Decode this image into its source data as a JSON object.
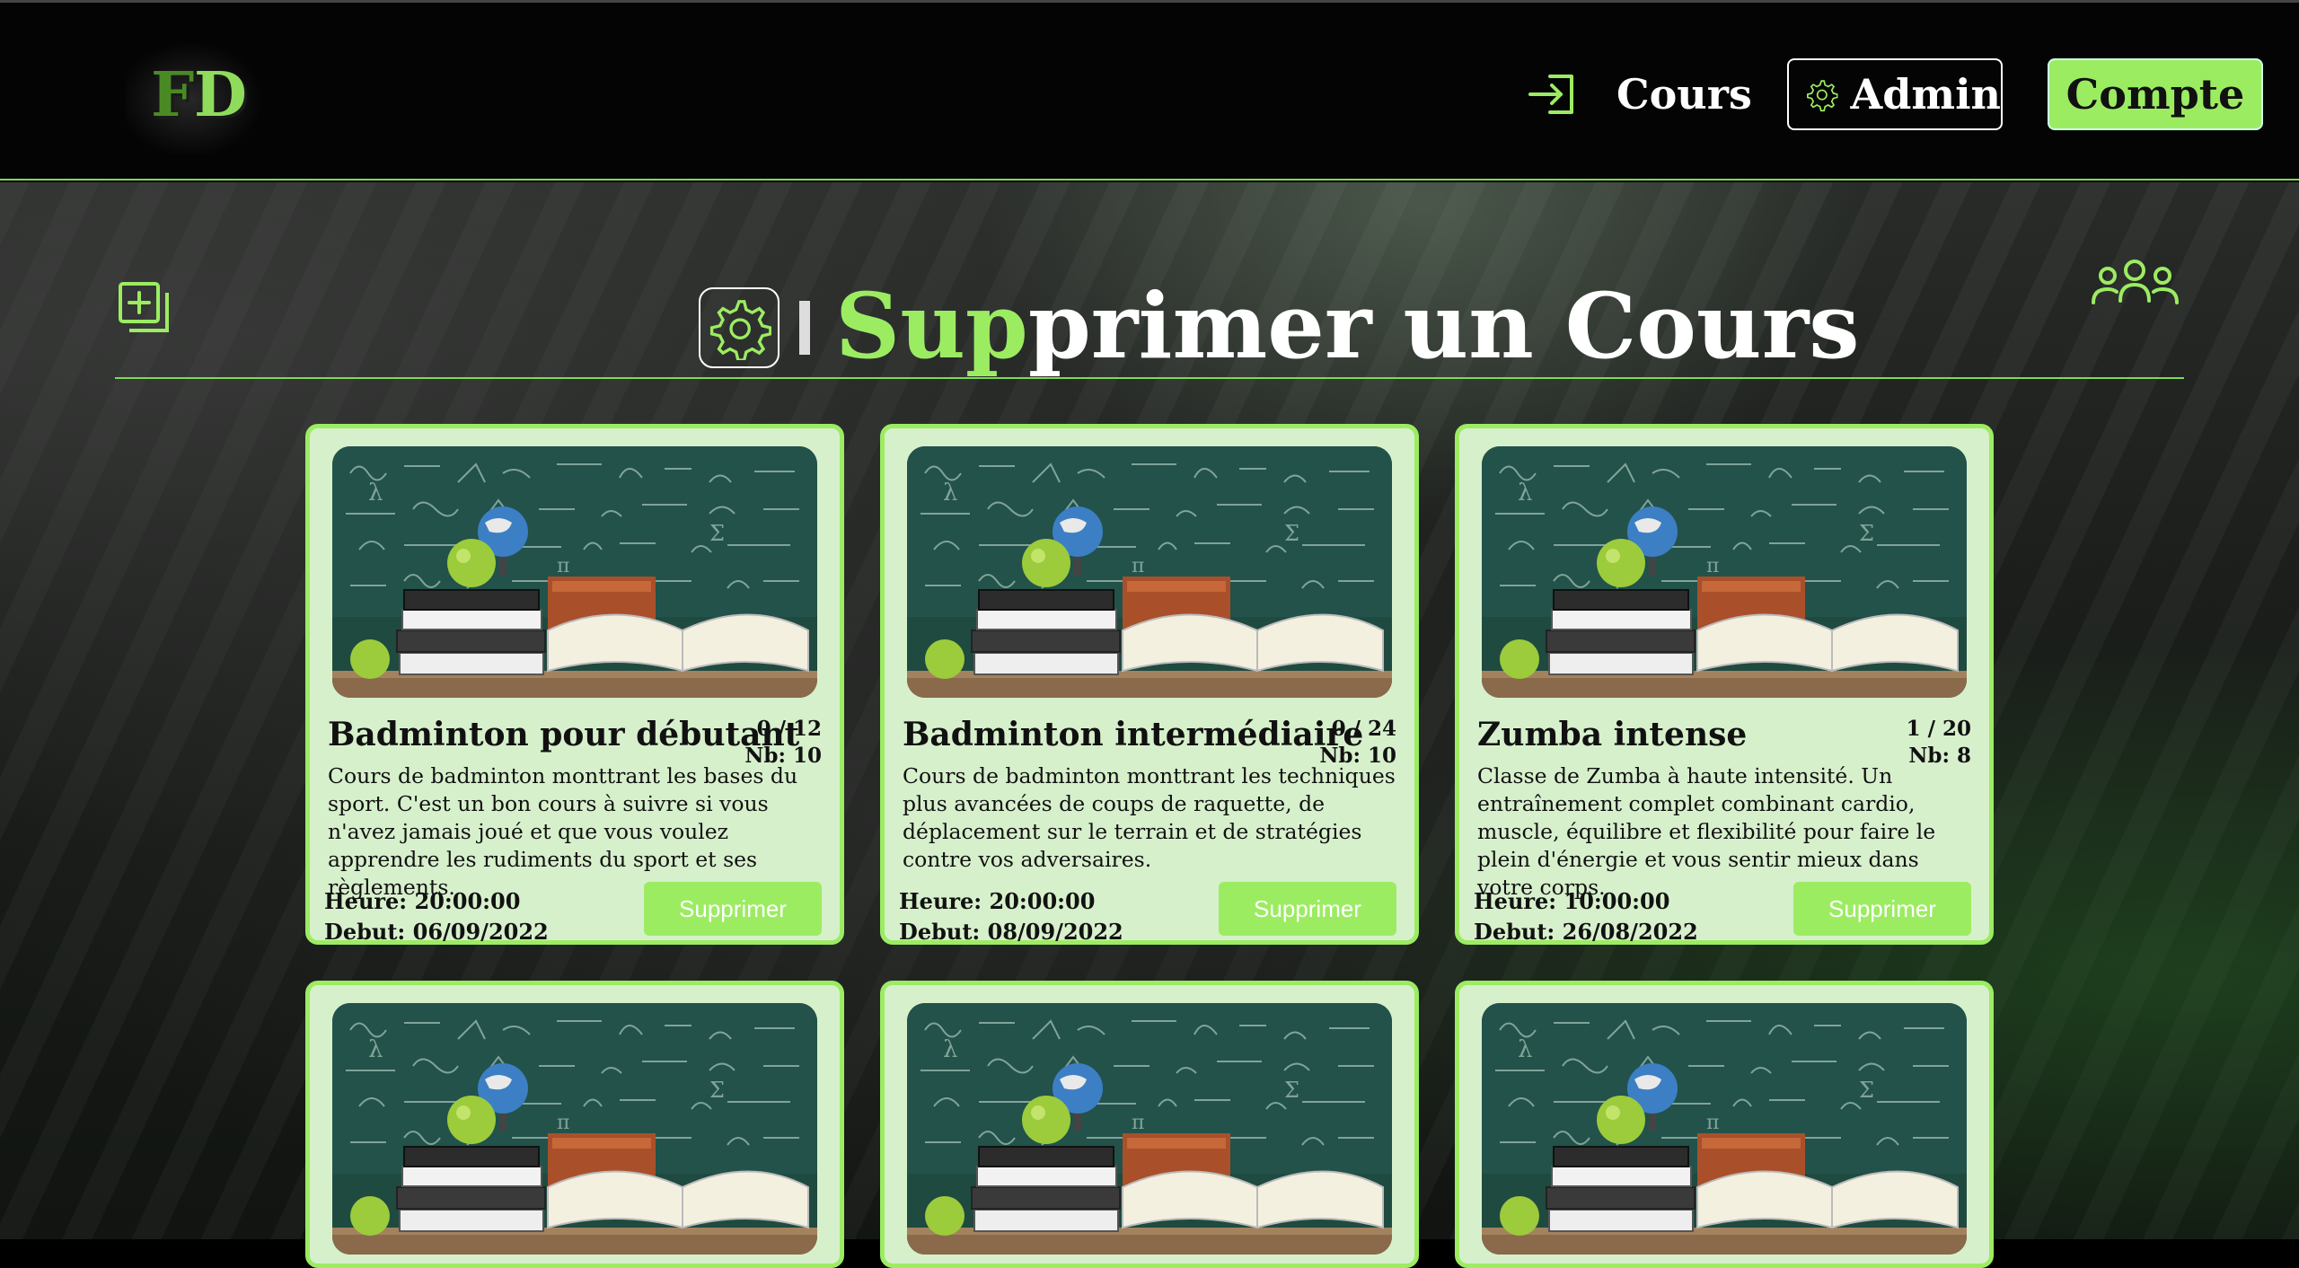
{
  "navbar": {
    "logo_f": "F",
    "logo_d": "D",
    "cours_label": "Cours",
    "admin_label": "Admin",
    "compte_label": "Compte",
    "login_icon": "sign-in-icon",
    "admin_icon": "gear-icon"
  },
  "page": {
    "title_accent": "Sup",
    "title_rest": "primer un Cours",
    "left_icon": "add-course-icon",
    "right_icon": "users-icon",
    "title_icon": "gear-icon"
  },
  "cards": [
    {
      "title": "Badminton pour débutant",
      "count": "0 / 12",
      "nb": "Nb: 10",
      "description": "Cours de badminton monttrant les bases du sport. C'est un bon cours à suivre si vous n'avez jamais joué et que vous voulez apprendre les rudiments du sport et ses règlements.",
      "heure": "Heure: 20:00:00",
      "debut": "Debut: 06/09/2022",
      "button": "Supprimer"
    },
    {
      "title": "Badminton intermédiaire",
      "count": "0 / 24",
      "nb": "Nb: 10",
      "description": "Cours de badminton monttrant les techniques plus avancées de coups de raquette, de déplacement sur le terrain et de stratégies contre vos adversaires.",
      "heure": "Heure: 20:00:00",
      "debut": "Debut: 08/09/2022",
      "button": "Supprimer"
    },
    {
      "title": "Zumba intense",
      "count": "1 / 20",
      "nb": "Nb: 8",
      "description": "Classe de Zumba à haute intensité. Un entraînement complet combinant cardio, muscle, équilibre et flexibilité pour faire le plein d'énergie et vous sentir mieux dans votre corps.",
      "heure": "Heure: 10:00:00",
      "debut": "Debut: 26/08/2022",
      "button": "Supprimer"
    }
  ],
  "colors": {
    "accent": "#9cec62",
    "card_bg": "#d7f0cc",
    "navbar_bg": "#040404"
  }
}
